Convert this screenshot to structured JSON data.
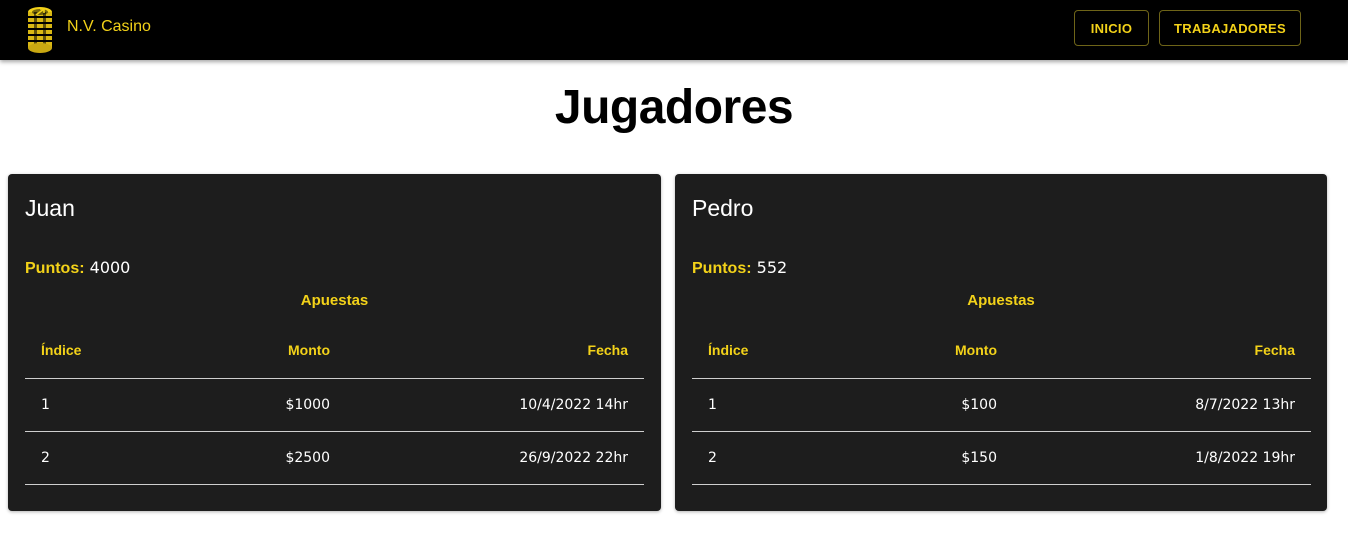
{
  "navbar": {
    "brand": "N.V. Casino",
    "logo_icon": "casino-chips-icon",
    "buttons": [
      "INICIO",
      "TRABAJADORES"
    ]
  },
  "page": {
    "title": "Jugadores"
  },
  "players": [
    {
      "name": "Juan",
      "points_label": "Puntos:",
      "points": "4000",
      "bets_title": "Apuestas",
      "columns": [
        "Índice",
        "Monto",
        "Fecha"
      ],
      "bets": [
        {
          "index": "1",
          "amount": "$1000",
          "date": "10/4/2022 14hr"
        },
        {
          "index": "2",
          "amount": "$2500",
          "date": "26/9/2022 22hr"
        }
      ]
    },
    {
      "name": "Pedro",
      "points_label": "Puntos:",
      "points": "552",
      "bets_title": "Apuestas",
      "columns": [
        "Índice",
        "Monto",
        "Fecha"
      ],
      "bets": [
        {
          "index": "1",
          "amount": "$100",
          "date": "8/7/2022 13hr"
        },
        {
          "index": "2",
          "amount": "$150",
          "date": "1/8/2022 19hr"
        }
      ]
    }
  ],
  "colors": {
    "accent": "#f3d219",
    "navbar": "#000000",
    "card": "#1d1d1d"
  }
}
